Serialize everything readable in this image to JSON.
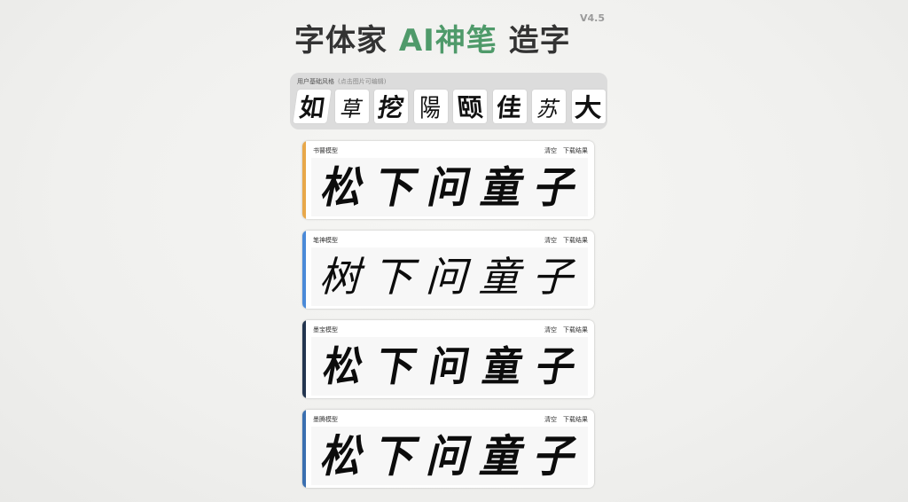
{
  "header": {
    "title_part1": "字体家",
    "title_accent": "AI神笔",
    "title_part2": "造字",
    "version": "V4.5"
  },
  "base_styles": {
    "label": "用户基础风格",
    "hint": "(点击图片可编辑)",
    "tiles": [
      "如",
      "草",
      "挖",
      "陽",
      "颐",
      "佳",
      "苏",
      "大"
    ]
  },
  "models": [
    {
      "name": "书瞽模型",
      "clear_label": "清空",
      "download_label": "下载结果",
      "color": "#e8a84a",
      "chars": [
        "松",
        "下",
        "问",
        "童",
        "子"
      ]
    },
    {
      "name": "笔神模型",
      "clear_label": "清空",
      "download_label": "下载结果",
      "color": "#4a8ad8",
      "chars": [
        "树",
        "下",
        "问",
        "童",
        "子"
      ]
    },
    {
      "name": "墨宝模型",
      "clear_label": "清空",
      "download_label": "下载结果",
      "color": "#23354f",
      "chars": [
        "松",
        "下",
        "问",
        "童",
        "子"
      ]
    },
    {
      "name": "墨腾模型",
      "clear_label": "清空",
      "download_label": "下载结果",
      "color": "#3a6fb0",
      "chars": [
        "松",
        "下",
        "问",
        "童",
        "子"
      ]
    }
  ]
}
